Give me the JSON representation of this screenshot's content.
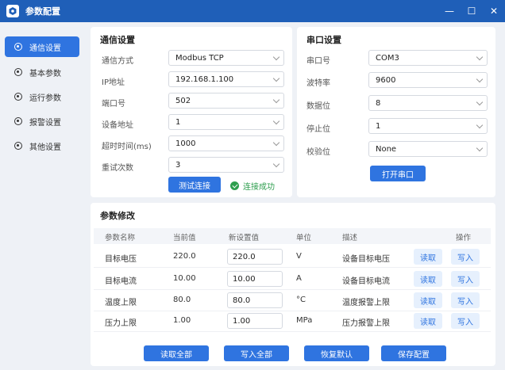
{
  "window": {
    "title": "参数配置",
    "minimize": "—",
    "maximize": "☐",
    "close": "✕"
  },
  "sidebar": {
    "items": [
      {
        "label": "通信设置",
        "active": true
      },
      {
        "label": "基本参数",
        "active": false
      },
      {
        "label": "运行参数",
        "active": false
      },
      {
        "label": "报警设置",
        "active": false
      },
      {
        "label": "其他设置",
        "active": false
      }
    ]
  },
  "comm": {
    "title": "通信设置",
    "fields": [
      {
        "label": "通信方式",
        "value": "Modbus TCP"
      },
      {
        "label": "IP地址",
        "value": "192.168.1.100"
      },
      {
        "label": "端口号",
        "value": "502"
      },
      {
        "label": "设备地址",
        "value": "1"
      },
      {
        "label": "超时时间(ms)",
        "value": "1000"
      },
      {
        "label": "重试次数",
        "value": "3"
      }
    ],
    "test_button": "测试连接",
    "status": "连接成功",
    "status_color": "#2e9e4e"
  },
  "serial": {
    "title": "串口设置",
    "fields": [
      {
        "label": "串口号",
        "value": "COM3"
      },
      {
        "label": "波特率",
        "value": "9600"
      },
      {
        "label": "数据位",
        "value": "8"
      },
      {
        "label": "停止位",
        "value": "1"
      },
      {
        "label": "校验位",
        "value": "None"
      }
    ],
    "open_button": "打开串口"
  },
  "params": {
    "title": "参数修改",
    "headers": [
      "参数名称",
      "当前值",
      "新设置值",
      "单位",
      "描述",
      "操作"
    ],
    "rows": [
      {
        "name": "目标电压",
        "current": "220.0",
        "new": "220.0",
        "unit": "V",
        "desc": "设备目标电压",
        "read": "读取",
        "write": "写入"
      },
      {
        "name": "目标电流",
        "current": "10.00",
        "new": "10.00",
        "unit": "A",
        "desc": "设备目标电流",
        "read": "读取",
        "write": "写入"
      },
      {
        "name": "温度上限",
        "current": "80.0",
        "new": "80.0",
        "unit": "°C",
        "desc": "温度报警上限",
        "read": "读取",
        "write": "写入"
      },
      {
        "name": "压力上限",
        "current": "1.00",
        "new": "1.00",
        "unit": "MPa",
        "desc": "压力报警上限",
        "read": "读取",
        "write": "写入"
      }
    ]
  },
  "actions": {
    "read_all": "读取全部",
    "write_all": "写入全部",
    "restore_default": "恢复默认",
    "save_config": "保存配置"
  },
  "colors": {
    "titlebar": "#1f5fb8",
    "accent": "#2f74e0",
    "success": "#2e9e4e"
  }
}
